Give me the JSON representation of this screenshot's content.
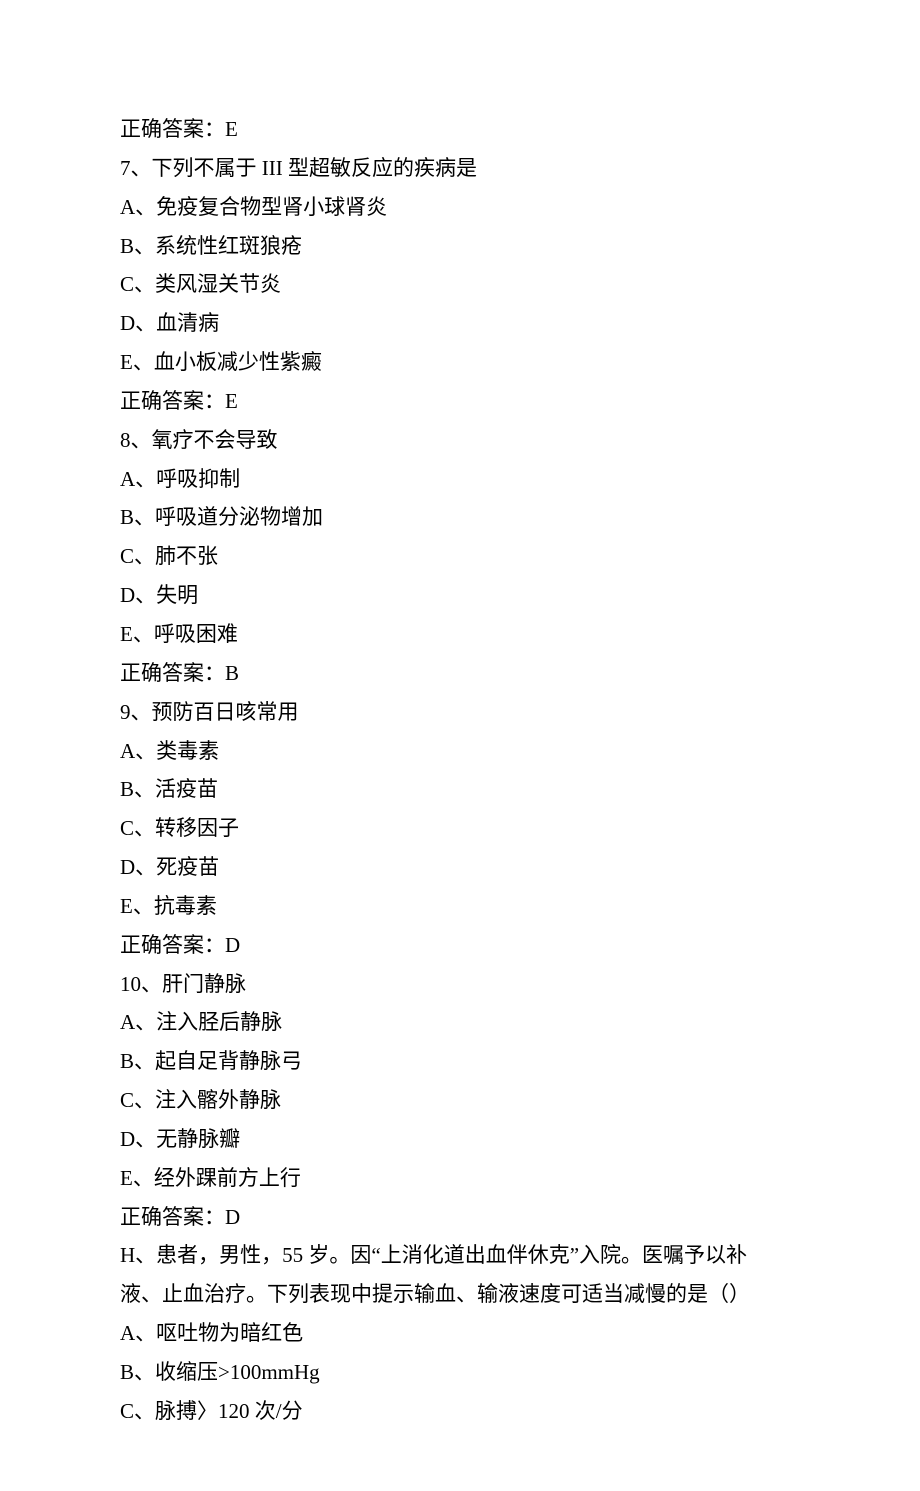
{
  "lines": [
    "正确答案：E",
    "7、下列不属于 III 型超敏反应的疾病是",
    "A、免疫复合物型肾小球肾炎",
    "B、系统性红斑狼疮",
    "C、类风湿关节炎",
    "D、血清病",
    "E、血小板减少性紫癜",
    "正确答案：E",
    "8、氧疗不会导致",
    "A、呼吸抑制",
    "B、呼吸道分泌物增加",
    "C、肺不张",
    "D、失明",
    "E、呼吸困难",
    "正确答案：B",
    "9、预防百日咳常用",
    "A、类毒素",
    "B、活疫苗",
    "C、转移因子",
    "D、死疫苗",
    "E、抗毒素",
    "正确答案：D",
    "10、肝门静脉",
    "A、注入胫后静脉",
    "B、起自足背静脉弓",
    "C、注入髂外静脉",
    "D、无静脉瓣",
    "E、经外踝前方上行",
    "正确答案：D",
    "H、患者，男性，55 岁。因“上消化道出血伴休克”入院。医嘱予以补",
    "液、止血治疗。下列表现中提示输血、输液速度可适当减慢的是（）",
    "A、呕吐物为暗红色",
    "B、收缩压>100mmHg",
    "C、脉搏〉120 次/分"
  ]
}
